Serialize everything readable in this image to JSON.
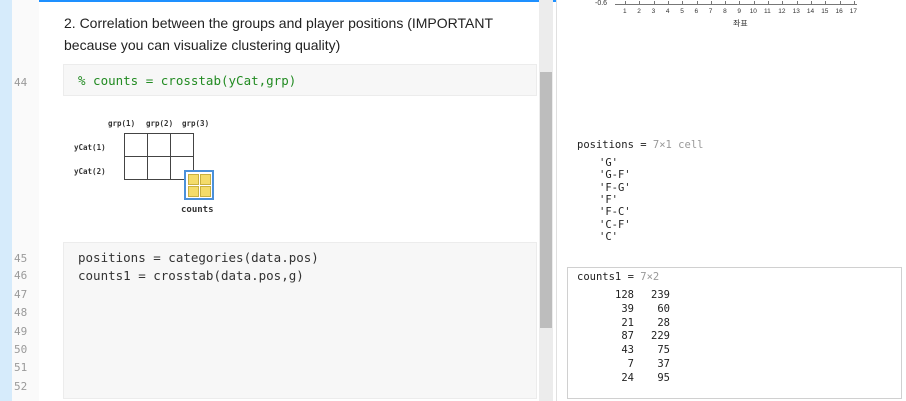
{
  "editor": {
    "text_line1": "2. Correlation between the groups and player positions (IMPORTANT",
    "text_line2": "because you can visualize clustering quality)",
    "code1": "% counts = crosstab(yCat,grp)",
    "code2_line1": "positions = categories(data.pos)",
    "code2_line2": "counts1 = crosstab(data.pos,g)",
    "line_numbers": [
      "44",
      "45",
      "46",
      "47",
      "48",
      "49",
      "50",
      "51",
      "52"
    ]
  },
  "diagram": {
    "col_labels": [
      "grp(1)",
      "grp(2)",
      "grp(3)"
    ],
    "row_labels": [
      "yCat(1)",
      "yCat(2)"
    ],
    "caption": "counts"
  },
  "plot_fragment": {
    "y_tick": "-0.6",
    "x_ticks": [
      "1",
      "2",
      "3",
      "4",
      "5",
      "6",
      "7",
      "8",
      "9",
      "10",
      "11",
      "12",
      "13",
      "14",
      "15",
      "16",
      "17"
    ],
    "x_label": "좌표"
  },
  "output": {
    "positions_name": "positions",
    "positions_eq": "=",
    "positions_dim": "7×1 cell",
    "positions_values": [
      "'G'",
      "'G-F'",
      "'F-G'",
      "'F'",
      "'F-C'",
      "'C-F'",
      "'C'"
    ],
    "counts1_name": "counts1",
    "counts1_eq": "=",
    "counts1_dim": "7×2",
    "counts1_rows": [
      [
        "128",
        "239"
      ],
      [
        "39",
        "60"
      ],
      [
        "21",
        "28"
      ],
      [
        "87",
        "229"
      ],
      [
        "43",
        "75"
      ],
      [
        "7",
        "37"
      ],
      [
        "24",
        "95"
      ]
    ]
  }
}
